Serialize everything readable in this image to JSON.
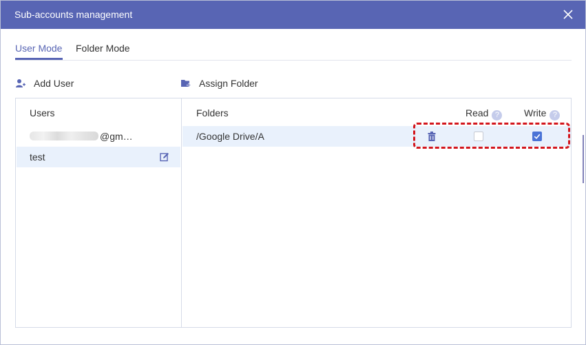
{
  "dialog": {
    "title": "Sub-accounts management",
    "close_icon": "close-icon"
  },
  "tabs": [
    {
      "label": "User Mode",
      "active": true
    },
    {
      "label": "Folder Mode",
      "active": false
    }
  ],
  "actions": {
    "add_user": {
      "label": "Add User",
      "icon": "add-user-icon"
    },
    "assign_folder": {
      "label": "Assign Folder",
      "icon": "add-folder-icon"
    }
  },
  "users_panel": {
    "header": "Users",
    "items": [
      {
        "email_suffix": "@gm…",
        "redacted": true,
        "selected": false
      },
      {
        "name": "test",
        "selected": true,
        "edit_icon": "edit-icon"
      }
    ]
  },
  "folders_panel": {
    "headers": {
      "folders": "Folders",
      "read": "Read",
      "write": "Write",
      "help_glyph": "?"
    },
    "rows": [
      {
        "path": "/Google Drive/A",
        "read": false,
        "write": true,
        "delete_icon": "trash-icon"
      }
    ]
  },
  "colors": {
    "titlebar": "#5865b4",
    "accent": "#5865b4",
    "selected_row": "#e9f1fc",
    "checkbox_checked": "#4a73d6",
    "highlight": "#d3151c"
  }
}
